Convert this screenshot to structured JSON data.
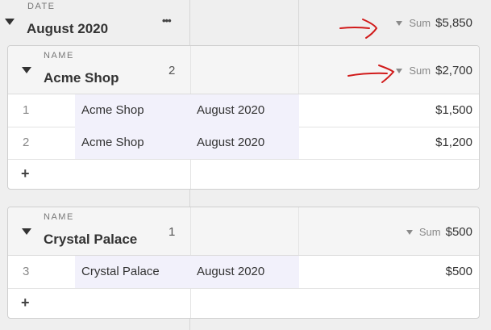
{
  "outer_group": {
    "caption": "DATE",
    "title": "August 2020",
    "more_label": "•••",
    "sum_label": "Sum",
    "sum_value": "$5,850"
  },
  "groups": [
    {
      "caption": "NAME",
      "title": "Acme Shop",
      "count": "2",
      "sum_label": "Sum",
      "sum_value": "$2,700",
      "rows": [
        {
          "num": "1",
          "name": "Acme Shop",
          "date": "August 2020",
          "amount": "$1,500"
        },
        {
          "num": "2",
          "name": "Acme Shop",
          "date": "August 2020",
          "amount": "$1,200"
        }
      ],
      "add_label": "+"
    },
    {
      "caption": "NAME",
      "title": "Crystal Palace",
      "count": "1",
      "sum_label": "Sum",
      "sum_value": "$500",
      "rows": [
        {
          "num": "3",
          "name": "Crystal Palace",
          "date": "August 2020",
          "amount": "$500"
        }
      ],
      "add_label": "+"
    }
  ],
  "annotation_color": "#d11a1a"
}
